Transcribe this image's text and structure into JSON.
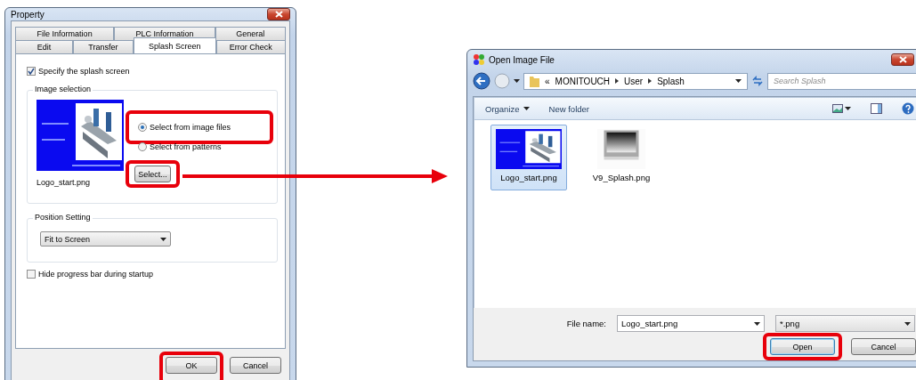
{
  "property_dialog": {
    "title": "Property",
    "tabs_back_row": [
      {
        "label": "File Information",
        "selected": false
      },
      {
        "label": "PLC Information",
        "selected": false
      },
      {
        "label": "General",
        "selected": false
      }
    ],
    "tabs_front_row": [
      {
        "label": "Edit",
        "selected": false
      },
      {
        "label": "Transfer",
        "selected": false
      },
      {
        "label": "Splash Screen",
        "selected": true
      },
      {
        "label": "Error Check",
        "selected": false
      }
    ],
    "specify_splash": {
      "label": "Specify the splash screen",
      "checked": true
    },
    "image_selection": {
      "title": "Image selection",
      "file_name": "Logo_start.png",
      "options": [
        {
          "label": "Select from image files",
          "selected": true,
          "highlighted": true
        },
        {
          "label": "Select from patterns",
          "selected": false,
          "highlighted": false
        }
      ],
      "select_button": {
        "label": "Select...",
        "highlighted": true
      }
    },
    "position_setting": {
      "title": "Position Setting",
      "value": "Fit to Screen"
    },
    "hide_progress": {
      "label": "Hide progress bar during startup",
      "checked": false
    },
    "buttons": [
      {
        "label": "OK",
        "highlighted": true
      },
      {
        "label": "Cancel",
        "highlighted": false
      }
    ]
  },
  "open_dialog": {
    "title": "Open Image File",
    "breadcrumb_overflow": "«",
    "breadcrumb": [
      "MONITOUCH",
      "User",
      "Splash"
    ],
    "search": {
      "placeholder": "Search Splash"
    },
    "toolbar": [
      "Organize",
      "New folder"
    ],
    "files": [
      {
        "name": "Logo_start.png",
        "selected": true
      },
      {
        "name": "V9_Splash.png",
        "selected": false
      }
    ],
    "file_name_label": "File name:",
    "file_name": "Logo_start.png",
    "filter": "*.png",
    "buttons": [
      {
        "label": "Open",
        "highlighted": true,
        "default": true
      },
      {
        "label": "Cancel",
        "highlighted": false,
        "default": false
      }
    ]
  }
}
